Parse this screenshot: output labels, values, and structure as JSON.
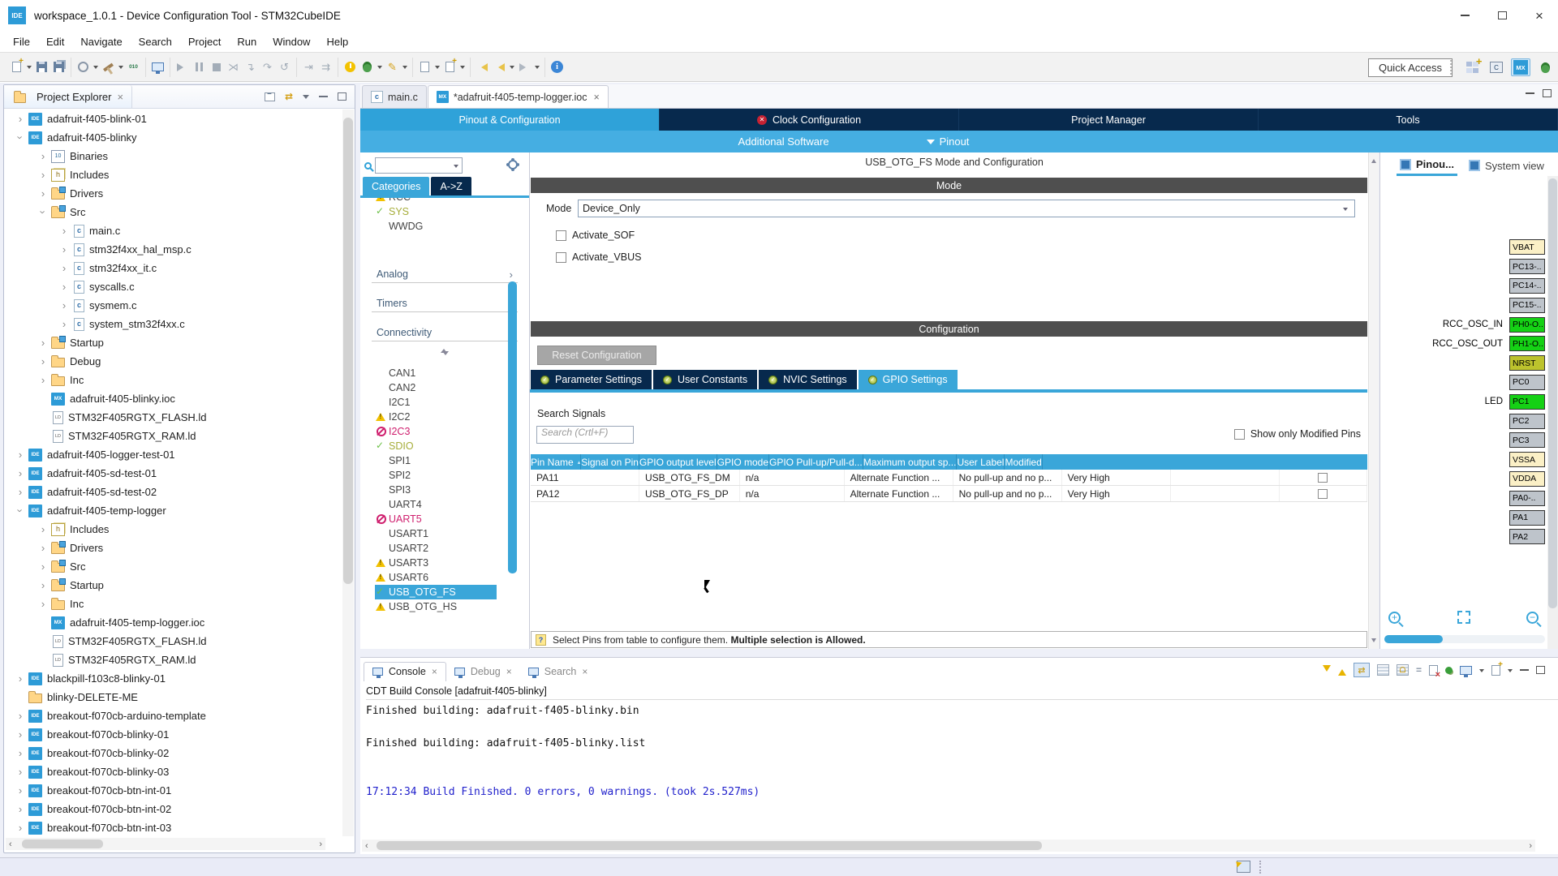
{
  "window": {
    "title": "workspace_1.0.1 - Device Configuration Tool - STM32CubeIDE"
  },
  "menu": [
    {
      "label": "File"
    },
    {
      "label": "Edit"
    },
    {
      "label": "Navigate"
    },
    {
      "label": "Search"
    },
    {
      "label": "Project"
    },
    {
      "label": "Run"
    },
    {
      "label": "Window"
    },
    {
      "label": "Help"
    }
  ],
  "toolbar": {
    "quick_access": "Quick Access",
    "icons": [
      "new-wizard",
      "save",
      "save-all",
      "external-tools",
      "build",
      "binary",
      "open-console",
      "resume",
      "suspend",
      "terminate",
      "disconnect",
      "step-into",
      "step-over",
      "step-return",
      "skip-breakpoints",
      "instruction-stepping",
      "launch-power",
      "debug",
      "program",
      "coverage",
      "profile",
      "last-edit",
      "back",
      "forward",
      "info"
    ]
  },
  "project_explorer": {
    "title": "Project Explorer",
    "tree": [
      {
        "cls": "d0",
        "arrow": "c",
        "icon": "ide",
        "label": "adafruit-f405-blink-01"
      },
      {
        "cls": "d0",
        "arrow": "e",
        "icon": "ide",
        "label": "adafruit-f405-blinky"
      },
      {
        "cls": "d1",
        "arrow": "c",
        "icon": "bin",
        "label": "Binaries"
      },
      {
        "cls": "d1",
        "arrow": "c",
        "icon": "inc",
        "label": "Includes"
      },
      {
        "cls": "d1",
        "arrow": "c",
        "icon": "folderc",
        "label": "Drivers"
      },
      {
        "cls": "d1",
        "arrow": "e",
        "icon": "folderc",
        "label": "Src"
      },
      {
        "cls": "d2",
        "arrow": "c",
        "icon": "cfile",
        "label": "main.c"
      },
      {
        "cls": "d2",
        "arrow": "c",
        "icon": "cfile",
        "label": "stm32f4xx_hal_msp.c"
      },
      {
        "cls": "d2",
        "arrow": "c",
        "icon": "cfile",
        "label": "stm32f4xx_it.c"
      },
      {
        "cls": "d2",
        "arrow": "c",
        "icon": "cfile",
        "label": "syscalls.c"
      },
      {
        "cls": "d2",
        "arrow": "c",
        "icon": "cfile",
        "label": "sysmem.c"
      },
      {
        "cls": "d2",
        "arrow": "c",
        "icon": "cfile",
        "label": "system_stm32f4xx.c"
      },
      {
        "cls": "d1",
        "arrow": "c",
        "icon": "folderc",
        "label": "Startup"
      },
      {
        "cls": "d1",
        "arrow": "c",
        "icon": "folder",
        "label": "Debug"
      },
      {
        "cls": "d1",
        "arrow": "c",
        "icon": "folder",
        "label": "Inc"
      },
      {
        "cls": "d1",
        "arrow": "n",
        "icon": "mx",
        "label": "adafruit-f405-blinky.ioc"
      },
      {
        "cls": "d1",
        "arrow": "n",
        "icon": "ld",
        "label": "STM32F405RGTX_FLASH.ld"
      },
      {
        "cls": "d1",
        "arrow": "n",
        "icon": "ld",
        "label": "STM32F405RGTX_RAM.ld"
      },
      {
        "cls": "d0",
        "arrow": "c",
        "icon": "ide",
        "label": "adafruit-f405-logger-test-01"
      },
      {
        "cls": "d0",
        "arrow": "c",
        "icon": "ide",
        "label": "adafruit-f405-sd-test-01"
      },
      {
        "cls": "d0",
        "arrow": "c",
        "icon": "ide",
        "label": "adafruit-f405-sd-test-02"
      },
      {
        "cls": "d0",
        "arrow": "e",
        "icon": "ide",
        "label": "adafruit-f405-temp-logger"
      },
      {
        "cls": "d1",
        "arrow": "c",
        "icon": "inc",
        "label": "Includes"
      },
      {
        "cls": "d1",
        "arrow": "c",
        "icon": "folderc",
        "label": "Drivers"
      },
      {
        "cls": "d1",
        "arrow": "c",
        "icon": "folderc",
        "label": "Src"
      },
      {
        "cls": "d1",
        "arrow": "c",
        "icon": "folderc",
        "label": "Startup"
      },
      {
        "cls": "d1",
        "arrow": "c",
        "icon": "folder",
        "label": "Inc"
      },
      {
        "cls": "d1",
        "arrow": "n",
        "icon": "mx",
        "label": "adafruit-f405-temp-logger.ioc"
      },
      {
        "cls": "d1",
        "arrow": "n",
        "icon": "ld",
        "label": "STM32F405RGTX_FLASH.ld"
      },
      {
        "cls": "d1",
        "arrow": "n",
        "icon": "ld",
        "label": "STM32F405RGTX_RAM.ld"
      },
      {
        "cls": "d0",
        "arrow": "c",
        "icon": "ide",
        "label": "blackpill-f103c8-blinky-01"
      },
      {
        "cls": "d0",
        "arrow": "n",
        "icon": "folder",
        "label": "blinky-DELETE-ME"
      },
      {
        "cls": "d0",
        "arrow": "c",
        "icon": "ide",
        "label": "breakout-f070cb-arduino-template"
      },
      {
        "cls": "d0",
        "arrow": "c",
        "icon": "ide",
        "label": "breakout-f070cb-blinky-01"
      },
      {
        "cls": "d0",
        "arrow": "c",
        "icon": "ide",
        "label": "breakout-f070cb-blinky-02"
      },
      {
        "cls": "d0",
        "arrow": "c",
        "icon": "ide",
        "label": "breakout-f070cb-blinky-03"
      },
      {
        "cls": "d0",
        "arrow": "c",
        "icon": "ide",
        "label": "breakout-f070cb-btn-int-01"
      },
      {
        "cls": "d0",
        "arrow": "c",
        "icon": "ide",
        "label": "breakout-f070cb-btn-int-02"
      },
      {
        "cls": "d0",
        "arrow": "c",
        "icon": "ide",
        "label": "breakout-f070cb-btn-int-03"
      }
    ]
  },
  "editor": {
    "tabs": [
      {
        "cls": "",
        "icon": "cfile",
        "label": "main.c"
      },
      {
        "cls": "active",
        "icon": "mx",
        "label": "*adafruit-f405-temp-logger.ioc"
      }
    ],
    "config_tabs": [
      {
        "cls": "active",
        "label": "Pinout & Configuration"
      },
      {
        "cls": "err",
        "label": "Clock Configuration"
      },
      {
        "cls": "",
        "label": "Project Manager"
      },
      {
        "cls": "",
        "label": "Tools"
      }
    ],
    "subbar": {
      "additional_software": "Additional Software",
      "pinout": "Pinout"
    }
  },
  "peripherals": {
    "search_placeholder": "",
    "tabs": [
      {
        "cls": "",
        "label": "Categories"
      },
      {
        "cls": "dark",
        "label": "A->Z"
      }
    ],
    "items": [
      {
        "cls": "itm warn clip",
        "label": "RCC"
      },
      {
        "cls": "itm ok",
        "label": "SYS"
      },
      {
        "cls": "itm plain",
        "label": "WWDG"
      },
      {
        "cls": "sec first",
        "label": "Analog"
      },
      {
        "cls": "sec",
        "label": "Timers"
      },
      {
        "cls": "sec open",
        "label": "Connectivity"
      },
      {
        "cls": "sorter",
        "label": ""
      },
      {
        "cls": "itm plain gap6",
        "label": "CAN1"
      },
      {
        "cls": "itm plain",
        "label": "CAN2"
      },
      {
        "cls": "itm plain",
        "label": "I2C1"
      },
      {
        "cls": "itm warn",
        "label": "I2C2"
      },
      {
        "cls": "itm block",
        "label": "I2C3"
      },
      {
        "cls": "itm ok",
        "label": "SDIO"
      },
      {
        "cls": "itm plain",
        "label": "SPI1"
      },
      {
        "cls": "itm plain",
        "label": "SPI2"
      },
      {
        "cls": "itm plain",
        "label": "SPI3"
      },
      {
        "cls": "itm plain",
        "label": "UART4"
      },
      {
        "cls": "itm block",
        "label": "UART5"
      },
      {
        "cls": "itm plain",
        "label": "USART1"
      },
      {
        "cls": "itm plain",
        "label": "USART2"
      },
      {
        "cls": "itm warn",
        "label": "USART3"
      },
      {
        "cls": "itm warn",
        "label": "USART6"
      },
      {
        "cls": "itm ok sel",
        "label": "USB_OTG_FS"
      },
      {
        "cls": "itm warn",
        "label": "USB_OTG_HS"
      }
    ]
  },
  "mode_panel": {
    "title": "USB_OTG_FS Mode and Configuration",
    "section": "Mode",
    "mode_label": "Mode",
    "mode_value": "Device_Only",
    "checkbox_sof": "Activate_SOF",
    "checkbox_vbus": "Activate_VBUS"
  },
  "config_panel": {
    "section": "Configuration",
    "reset_button": "Reset Configuration",
    "tabs": [
      {
        "cls": "",
        "label": "Parameter Settings"
      },
      {
        "cls": "",
        "label": "User Constants"
      },
      {
        "cls": "",
        "label": "NVIC Settings"
      },
      {
        "cls": "active",
        "label": "GPIO Settings"
      }
    ],
    "search_label": "Search Signals",
    "search_placeholder": "Search (Crtl+F)",
    "show_modified_label": "Show only Modified Pins",
    "table": {
      "columns": [
        {
          "label": "Pin Name"
        },
        {
          "label": "Signal on Pin"
        },
        {
          "label": "GPIO output level"
        },
        {
          "label": "GPIO mode"
        },
        {
          "label": "GPIO Pull-up/Pull-d..."
        },
        {
          "label": "Maximum output sp..."
        },
        {
          "label": "User Label"
        },
        {
          "label": "Modified"
        }
      ],
      "rows": [
        {
          "pin": "PA11",
          "signal": "USB_OTG_FS_DM",
          "level": "n/a",
          "mode": "Alternate Function ...",
          "pull": "No pull-up and no p...",
          "speed": "Very High",
          "user": ""
        },
        {
          "pin": "PA12",
          "signal": "USB_OTG_FS_DP",
          "level": "n/a",
          "mode": "Alternate Function ...",
          "pull": "No pull-up and no p...",
          "speed": "Very High",
          "user": ""
        }
      ]
    },
    "hint_text": "Select Pins from table to configure them.",
    "hint_bold": "Multiple selection is Allowed."
  },
  "pinout_panel": {
    "tabs": [
      {
        "cls": "active",
        "label": "Pinou..."
      },
      {
        "cls": "plain",
        "label": "System view"
      }
    ],
    "zoom_icons": [
      "zoom-in",
      "best-fit",
      "zoom-out"
    ],
    "pins": [
      {
        "label": "",
        "name": "VBAT",
        "cls": "cream"
      },
      {
        "label": "",
        "name": "PC13-..",
        "cls": "gray"
      },
      {
        "label": "",
        "name": "PC14-..",
        "cls": "gray"
      },
      {
        "label": "",
        "name": "PC15-..",
        "cls": "gray"
      },
      {
        "label": "RCC_OSC_IN",
        "name": "PH0-O..",
        "cls": "green"
      },
      {
        "label": "RCC_OSC_OUT",
        "name": "PH1-O..",
        "cls": "green"
      },
      {
        "label": "",
        "name": "NRST",
        "cls": "olive"
      },
      {
        "label": "",
        "name": "PC0",
        "cls": "gray"
      },
      {
        "label": "LED",
        "name": "PC1",
        "cls": "green"
      },
      {
        "label": "",
        "name": "PC2",
        "cls": "gray"
      },
      {
        "label": "",
        "name": "PC3",
        "cls": "gray"
      },
      {
        "label": "",
        "name": "VSSA",
        "cls": "cream"
      },
      {
        "label": "",
        "name": "VDDA",
        "cls": "cream"
      },
      {
        "label": "",
        "name": "PA0-..",
        "cls": "gray"
      },
      {
        "label": "",
        "name": "PA1",
        "cls": "gray"
      },
      {
        "label": "",
        "name": "PA2",
        "cls": "gray"
      }
    ]
  },
  "console": {
    "tabs": [
      {
        "cls": "active",
        "label": "Console"
      },
      {
        "cls": "",
        "label": "Debug"
      },
      {
        "cls": "",
        "label": "Search"
      }
    ],
    "toolbar_icons": [
      "scroll-down",
      "scroll-up",
      "show-console-on-output",
      "scroll-lock",
      "word-wrap-lock",
      "line-wrap",
      "clear-console",
      "pin-console",
      "display-selected-console",
      "open-console",
      "minimize",
      "maximize"
    ],
    "subtitle": "CDT Build Console [adafruit-f405-blinky]",
    "lines": [
      {
        "t": "Finished building: adafruit-f405-blinky.bin",
        "cls": ""
      },
      {
        "t": "",
        "cls": ""
      },
      {
        "t": "Finished building: adafruit-f405-blinky.list",
        "cls": ""
      },
      {
        "t": "",
        "cls": ""
      },
      {
        "t": "",
        "cls": ""
      },
      {
        "t": "17:12:34 Build Finished. 0 errors, 0 warnings. (took 2s.527ms)",
        "cls": "blue"
      }
    ]
  },
  "colors": {
    "accent_blue": "#39a9dc",
    "dark_navy": "#07294d",
    "section_gray": "#4f4f4f",
    "ok_green": "#6cc047",
    "ok_label": "#a6ad3a",
    "warn_yellow": "#f2c100",
    "block_magenta": "#cf1f6e",
    "console_blue": "#2121cc",
    "pin_green": "#15d115",
    "pin_cream": "#fbf0c6",
    "pin_gray": "#bec4cb",
    "pin_olive": "#bcc32d"
  }
}
